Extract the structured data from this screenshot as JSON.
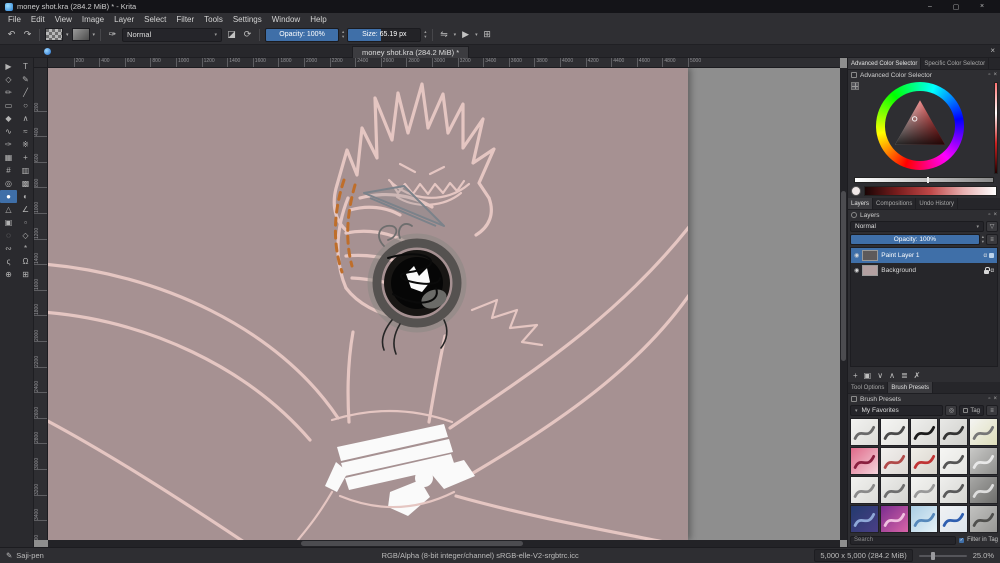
{
  "theme": {
    "accent": "#3f6fa8",
    "canvas_bg": "#a69192",
    "line_pink": "#e5c6c2",
    "outside_canvas": "#8e8e8e"
  },
  "window": {
    "title": "money shot.kra (284.2 MiB) * - Krita",
    "controls": [
      {
        "name": "minimize",
        "glyph": "–"
      },
      {
        "name": "maximize",
        "glyph": "▢"
      },
      {
        "name": "close",
        "glyph": "×"
      }
    ]
  },
  "menu": [
    "File",
    "Edit",
    "View",
    "Image",
    "Layer",
    "Select",
    "Filter",
    "Tools",
    "Settings",
    "Window",
    "Help"
  ],
  "icons": {
    "undo": "↶",
    "redo": "↷",
    "arrow_down": "▾",
    "arrow_up": "▴",
    "eraser": "◪",
    "reload": "⟳",
    "mirror": "⇋",
    "play": "▶",
    "crop_frame": "⊞",
    "brush_settings": "✑",
    "menu": "≡",
    "funnel": "▽",
    "float": "▫",
    "close": "×",
    "eye": "◉",
    "alpha": "α",
    "check": "✓",
    "brush_tip": "✎",
    "search": "◎"
  },
  "toolbar": {
    "blending_mode": "Normal",
    "opacity": "Opacity: 100%",
    "opacity_fill_pct": 100,
    "size": "Size: 65.19 px",
    "size_fill_pct": 46
  },
  "document_tab": "money shot.kra (284.2 MiB) *",
  "toolbox": {
    "active_index": 20,
    "tools": [
      {
        "name": "select-shapes-tool",
        "glyph": "▶"
      },
      {
        "name": "text-tool",
        "glyph": "T"
      },
      {
        "name": "edit-shapes-tool",
        "glyph": "◇"
      },
      {
        "name": "calligraphy-tool",
        "glyph": "✎"
      },
      {
        "name": "freehand-brush-tool",
        "glyph": "✏"
      },
      {
        "name": "line-tool",
        "glyph": "╱"
      },
      {
        "name": "rectangle-tool",
        "glyph": "▭"
      },
      {
        "name": "ellipse-tool",
        "glyph": "○"
      },
      {
        "name": "polygon-tool",
        "glyph": "◆"
      },
      {
        "name": "polyline-tool",
        "glyph": "∧"
      },
      {
        "name": "bezier-curve-tool",
        "glyph": "∿"
      },
      {
        "name": "freehand-path-tool",
        "glyph": "≈"
      },
      {
        "name": "dynamic-brush-tool",
        "glyph": "✑"
      },
      {
        "name": "multibrush-tool",
        "glyph": "※"
      },
      {
        "name": "transform-tool",
        "glyph": "▦"
      },
      {
        "name": "move-tool",
        "glyph": "+"
      },
      {
        "name": "crop-tool",
        "glyph": "#"
      },
      {
        "name": "gradient-tool",
        "glyph": "▥"
      },
      {
        "name": "color-sampler-tool",
        "glyph": "◎"
      },
      {
        "name": "pattern-edit-tool",
        "glyph": "▩"
      },
      {
        "name": "fill-tool",
        "glyph": "●"
      },
      {
        "name": "enclose-fill-tool",
        "glyph": "◐"
      },
      {
        "name": "assistants-tool",
        "glyph": "△"
      },
      {
        "name": "measure-tool",
        "glyph": "∠"
      },
      {
        "name": "reference-images-tool",
        "glyph": "▣"
      },
      {
        "name": "rectangular-select-tool",
        "glyph": "▫"
      },
      {
        "name": "elliptical-select-tool",
        "glyph": "◌"
      },
      {
        "name": "polygonal-select-tool",
        "glyph": "◇"
      },
      {
        "name": "freehand-select-tool",
        "glyph": "∾"
      },
      {
        "name": "similar-color-select-tool",
        "glyph": "*"
      },
      {
        "name": "bezier-select-tool",
        "glyph": "ς"
      },
      {
        "name": "magnetic-select-tool",
        "glyph": "Ω"
      },
      {
        "name": "zoom-tool",
        "glyph": "⊕"
      },
      {
        "name": "pan-tool",
        "glyph": "⊞"
      }
    ]
  },
  "ruler": {
    "scale": 0.128,
    "h_labels": [
      200,
      400,
      600,
      800,
      1000,
      1200,
      1400,
      1600,
      1800,
      2000,
      2200,
      2400,
      2600,
      2800,
      3000,
      3200,
      3400,
      3600,
      3800,
      4000,
      4200,
      4400,
      4600,
      4800,
      5000
    ],
    "v_labels": [
      200,
      400,
      600,
      800,
      1000,
      1200,
      1400,
      1600,
      1800,
      2000,
      2200,
      2400,
      2600,
      2800,
      3000,
      3200,
      3400,
      3600
    ]
  },
  "color_docker": {
    "tabs": [
      "Advanced Color Selector",
      "Specific Color Selector"
    ],
    "active_tab": "Advanced Color Selector",
    "header": "Advanced Color Selector",
    "current_color": "#f0e8e7",
    "shade_gradient": [
      "#1a0505",
      "#7a1d1d",
      "#c04848",
      "#e8b0b0",
      "#ffffff"
    ],
    "value_gradient": [
      "#ffffff",
      "#8a8a8a"
    ],
    "strip_gradient": [
      "#ff7070",
      "#ffffff",
      "#cc2222",
      "#220000"
    ]
  },
  "layers_docker": {
    "tabs": [
      "Layers",
      "Compositions",
      "Undo History"
    ],
    "active_tab": "Layers",
    "header": "Layers",
    "blending_mode": "Normal",
    "opacity_label": "Opacity: 100%",
    "opacity_fill_pct": 100,
    "layers": [
      {
        "name": "Paint Layer 1",
        "selected": true,
        "thumb": "#5e5a5b"
      },
      {
        "name": "Background",
        "selected": false,
        "thumb": "#b3a0a1",
        "locked": true
      }
    ],
    "buttons": [
      {
        "name": "add-layer",
        "glyph": "+"
      },
      {
        "name": "duplicate-layer",
        "glyph": "▣"
      },
      {
        "name": "move-layer-down",
        "glyph": "∨"
      },
      {
        "name": "move-layer-up",
        "glyph": "∧"
      },
      {
        "name": "layer-properties",
        "glyph": "≣"
      },
      {
        "name": "delete-layer",
        "glyph": "✗"
      }
    ]
  },
  "presets_docker": {
    "tabs": [
      "Tool Options",
      "Brush Presets"
    ],
    "active_tab": "Brush Presets",
    "header": "Brush Presets",
    "favorites": "My Favorites",
    "tag_label": "Tag",
    "search_placeholder": "Search",
    "filter_label": "Filter in Tag",
    "brushes": [
      {
        "bg1": "#f2f2f0",
        "bg2": "#dcdcd8",
        "stroke": "#6a6a6a"
      },
      {
        "bg1": "#f5f5f3",
        "bg2": "#e2e2de",
        "stroke": "#4a4a4a"
      },
      {
        "bg1": "#efefed",
        "bg2": "#d8d8d4",
        "stroke": "#1a1a1a"
      },
      {
        "bg1": "#e8e8e6",
        "bg2": "#cfcfcb",
        "stroke": "#333333"
      },
      {
        "bg1": "#f4f4f2",
        "bg2": "#dedeba",
        "stroke": "#777777"
      },
      {
        "bg1": "#e06a8a",
        "bg2": "#f4d4dc",
        "stroke": "#8a1f3f"
      },
      {
        "bg1": "#f2f0ee",
        "bg2": "#ddd8d4",
        "stroke": "#b04a4a"
      },
      {
        "bg1": "#f0eee8",
        "bg2": "#d8d4cc",
        "stroke": "#c03434"
      },
      {
        "bg1": "#f6f6f4",
        "bg2": "#e4e4e0",
        "stroke": "#555555"
      },
      {
        "bg1": "#c9c9c7",
        "bg2": "#8f8f8d",
        "stroke": "#e8e8e8"
      },
      {
        "bg1": "#f1f1ef",
        "bg2": "#dcdcd8",
        "stroke": "#8a8a8a"
      },
      {
        "bg1": "#ededeb",
        "bg2": "#d4d4d0",
        "stroke": "#6f6f6f"
      },
      {
        "bg1": "#f3f3f1",
        "bg2": "#e0e0dc",
        "stroke": "#9a9a9a"
      },
      {
        "bg1": "#efefed",
        "bg2": "#d6d6d2",
        "stroke": "#5a5a5a"
      },
      {
        "bg1": "#a8a8a6",
        "bg2": "#6e6e6c",
        "stroke": "#dddddd"
      },
      {
        "bg1": "#233a6e",
        "bg2": "#4a3f86",
        "stroke": "#8fa8d8"
      },
      {
        "bg1": "#7a2d8e",
        "bg2": "#d964a8",
        "stroke": "#f0c0e0"
      },
      {
        "bg1": "#aacde4",
        "bg2": "#e6f2f8",
        "stroke": "#5588bb"
      },
      {
        "bg1": "#f0f2f4",
        "bg2": "#dce4ec",
        "stroke": "#2f5fb0"
      },
      {
        "bg1": "#c2c2c0",
        "bg2": "#979795",
        "stroke": "#4f4f4d"
      }
    ]
  },
  "status_bar": {
    "brush_name": "Saji-pen",
    "color_profile": "RGB/Alpha (8-bit integer/channel)  sRGB-elle-V2-srgbtrc.icc",
    "canvas_size": "5,000 x 5,000 (284.2 MiB)",
    "zoom": "25.0%"
  }
}
